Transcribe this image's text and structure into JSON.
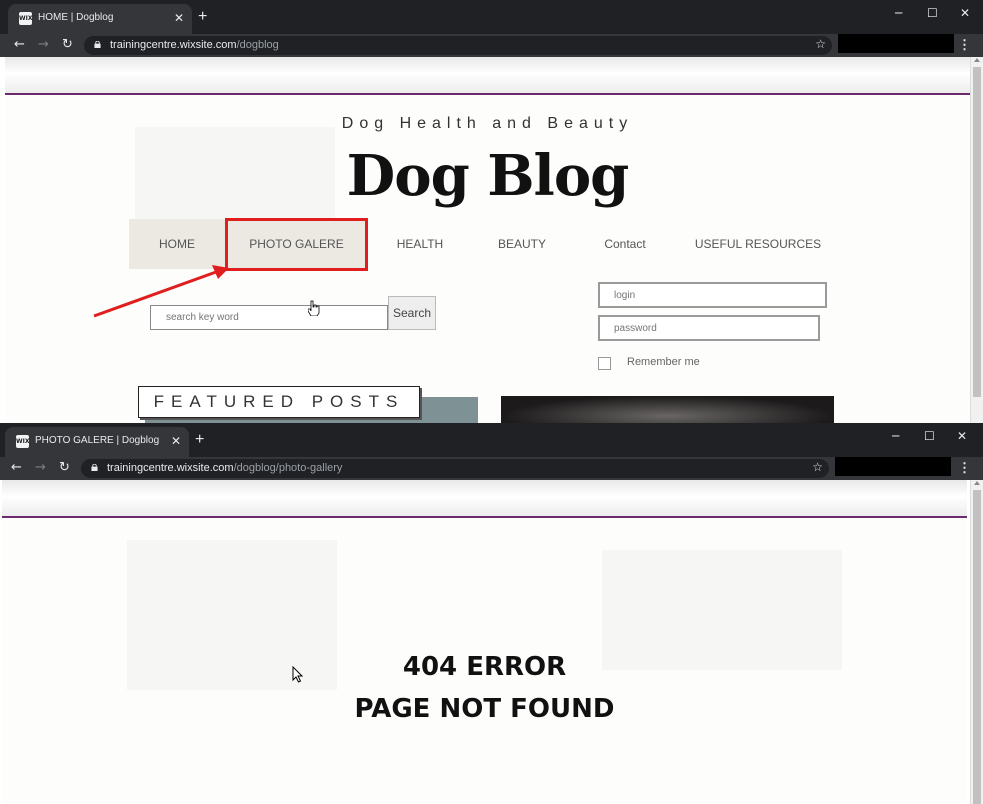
{
  "window1": {
    "tab_title": "HOME | Dogblog",
    "favicon_text": "WIX",
    "url_host": "trainingcentre.wixsite.com",
    "url_path": "/dogblog",
    "page": {
      "tagline": "Dog Health and Beauty",
      "title": "Dog Blog",
      "nav": [
        "HOME",
        "PHOTO GALERE",
        "HEALTH",
        "BEAUTY",
        "Contact",
        "USEFUL RESOURCES"
      ],
      "search_placeholder": "search key word",
      "search_button": "Search",
      "login_placeholder": "login",
      "password_placeholder": "password",
      "remember_label": "Remember me",
      "featured_heading": "FEATURED POSTS"
    }
  },
  "window2": {
    "tab_title": "PHOTO GALERE | Dogblog",
    "favicon_text": "WIX",
    "url_host": "trainingcentre.wixsite.com",
    "url_path": "/dogblog/photo-gallery",
    "page": {
      "error_line1": "404 ERROR",
      "error_line2": "PAGE NOT FOUND"
    }
  },
  "colors": {
    "annotation_red": "#e01e1e",
    "header_purple": "#6b2a6b",
    "chrome_dark": "#202124"
  }
}
